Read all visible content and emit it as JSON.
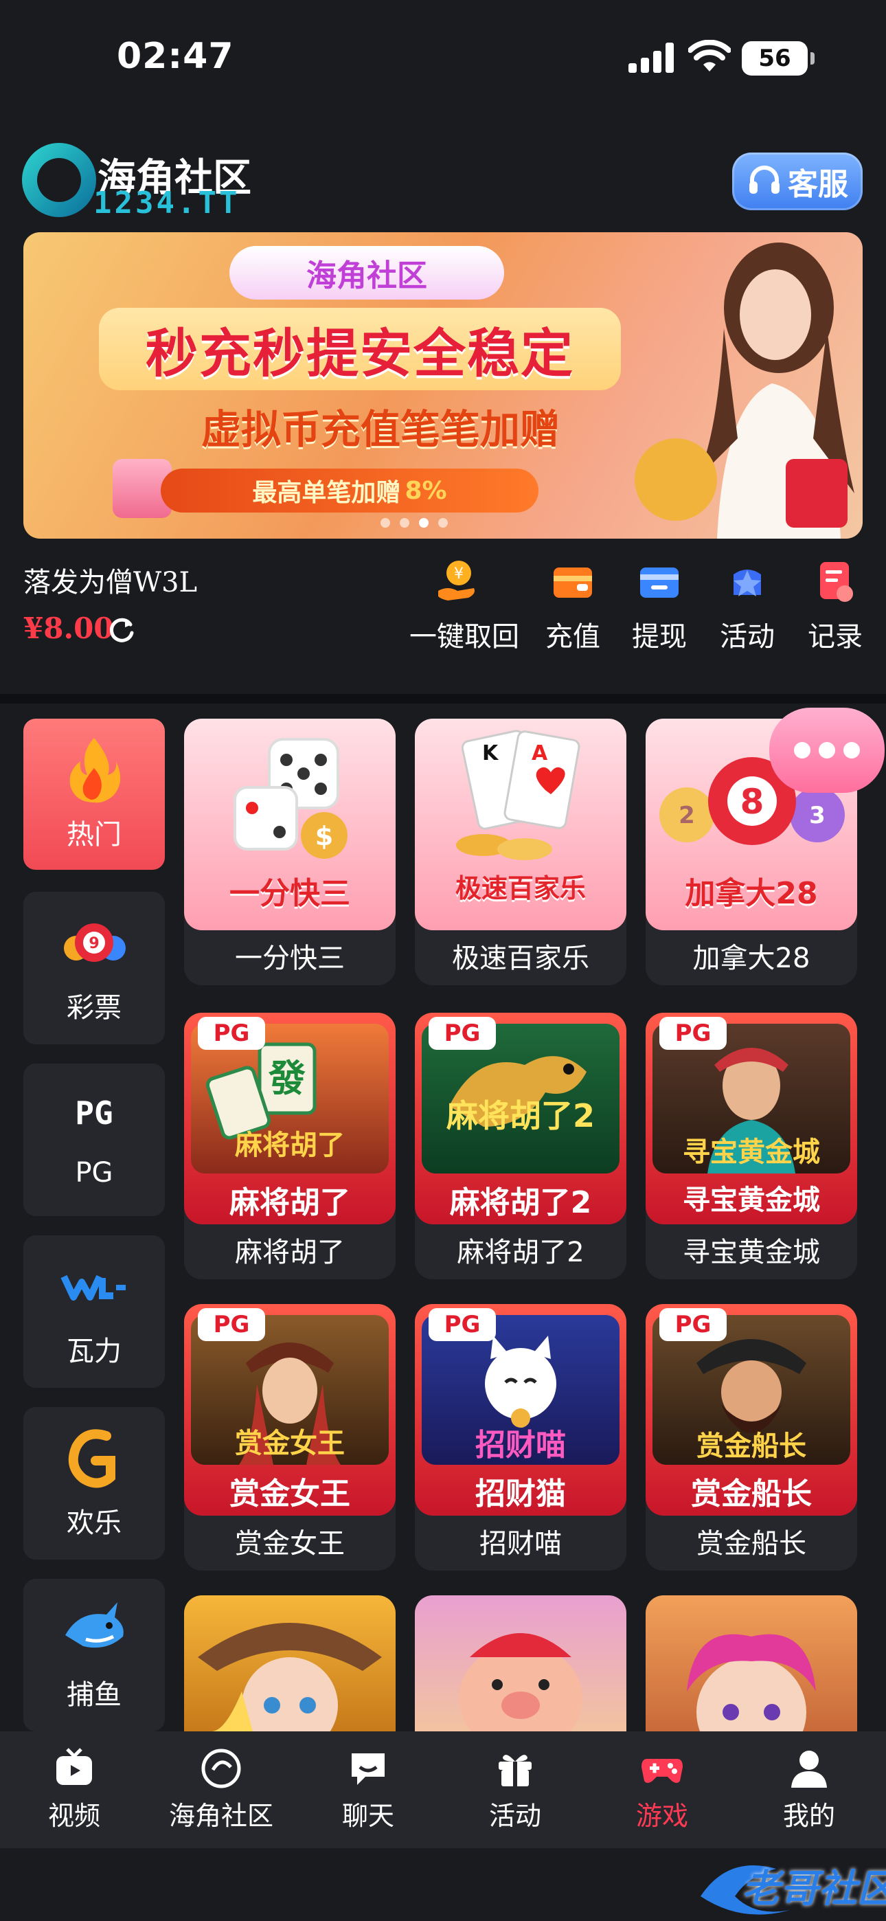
{
  "status_bar": {
    "time": "02:47",
    "battery": "56"
  },
  "header": {
    "logo_title": "海角社区",
    "logo_url": "1234.TT",
    "customer_service": "客服"
  },
  "banner": {
    "brand": "海角社区",
    "headline": "秒充秒提安全稳定",
    "subline": "虚拟币充值笔笔加赠",
    "pill_text": "最高单笔加赠",
    "pill_value": "8%"
  },
  "user": {
    "name": "落发为僧W3L",
    "balance": "¥8.00"
  },
  "actions": [
    {
      "label": "一键取回",
      "icon": "coin-hand-icon"
    },
    {
      "label": "充值",
      "icon": "wallet-icon"
    },
    {
      "label": "提现",
      "icon": "withdraw-icon"
    },
    {
      "label": "活动",
      "icon": "star-icon"
    },
    {
      "label": "记录",
      "icon": "record-icon"
    }
  ],
  "sidebar": [
    {
      "label": "热门",
      "icon": "flame-icon",
      "active": true
    },
    {
      "label": "彩票",
      "icon": "lottery-ball-icon"
    },
    {
      "label": "PG",
      "icon": "pg-logo-icon"
    },
    {
      "label": "瓦力",
      "icon": "wali-logo-icon"
    },
    {
      "label": "欢乐",
      "icon": "huanle-logo-icon"
    },
    {
      "label": "捕鱼",
      "icon": "shark-icon"
    }
  ],
  "games": [
    {
      "name": "一分快三",
      "art_title": "一分快三"
    },
    {
      "name": "极速百家乐",
      "art_title": "极速百家乐"
    },
    {
      "name": "加拿大28",
      "art_title": "加拿大28"
    },
    {
      "name": "麻将胡了",
      "art_title": "麻将胡了",
      "badge": "PG"
    },
    {
      "name": "麻将胡了2",
      "art_title": "麻将胡了2",
      "badge": "PG"
    },
    {
      "name": "寻宝黄金城",
      "art_title": "寻宝黄金城",
      "badge": "PG"
    },
    {
      "name": "赏金女王",
      "art_title": "赏金女王",
      "badge": "PG"
    },
    {
      "name": "招财喵",
      "art_title": "招财猫",
      "badge": "PG"
    },
    {
      "name": "赏金船长",
      "art_title": "赏金船长",
      "badge": "PG"
    }
  ],
  "bottom_nav": [
    {
      "label": "视频",
      "icon": "tv-icon"
    },
    {
      "label": "海角社区",
      "icon": "haijiao-logo-icon"
    },
    {
      "label": "聊天",
      "icon": "chat-icon"
    },
    {
      "label": "活动",
      "icon": "gift-icon"
    },
    {
      "label": "游戏",
      "icon": "gamepad-icon",
      "active": true
    },
    {
      "label": "我的",
      "icon": "user-icon"
    }
  ],
  "watermark": "老哥社区",
  "colors": {
    "accent_red": "#ff3a55",
    "panel": "#26272c",
    "background": "#1a1b1f"
  }
}
